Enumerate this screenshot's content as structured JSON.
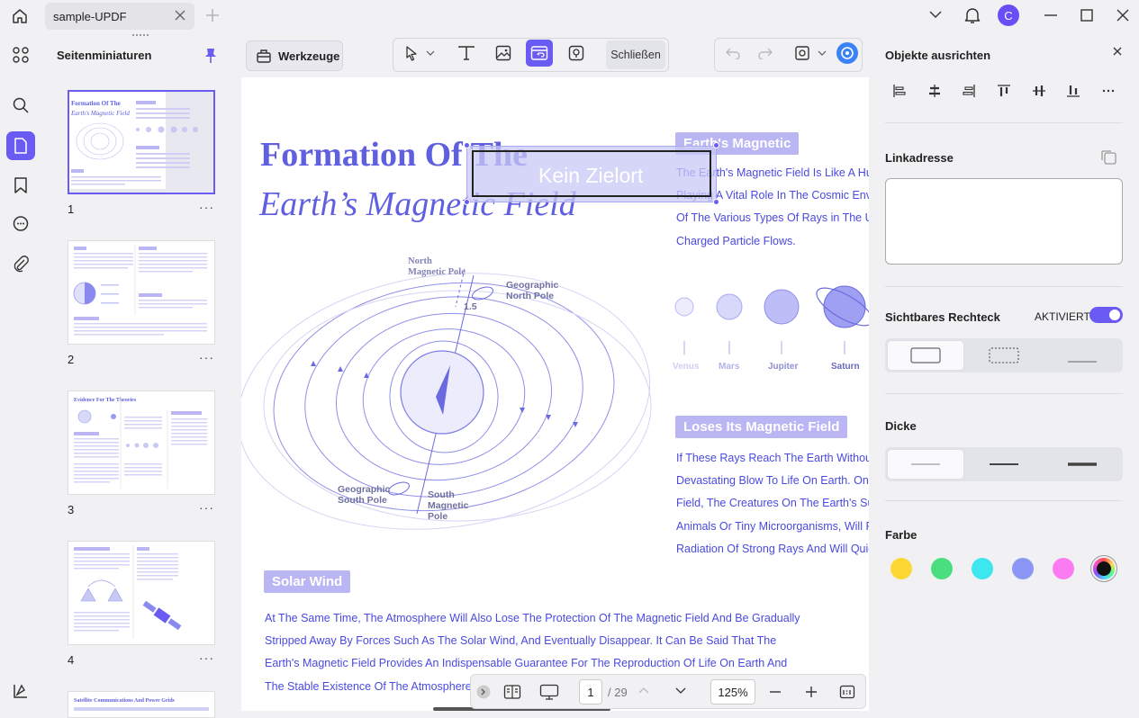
{
  "titlebar": {
    "tab_title": "sample-UPDF",
    "avatar_letter": "C"
  },
  "thumbnails": {
    "title": "Seitenminiaturen",
    "pages": [
      {
        "number": "1",
        "more": "···"
      },
      {
        "number": "2",
        "more": "···"
      },
      {
        "number": "3",
        "more": "···"
      },
      {
        "number": "4",
        "more": "···"
      }
    ]
  },
  "toolbar": {
    "tools_label": "Werkzeuge",
    "close_label": "Schließen"
  },
  "document": {
    "title_line1": "Formation Of The",
    "title_line2": "Earth’s Magnetic Field",
    "section1_title": "Earth's Magnetic",
    "section1_lines": [
      "The Earth's Magnetic Field Is Like A Huge",
      "Playing A Vital Role In The Cosmic Enviro",
      "Of The Various Types Of Rays in The Uni",
      "Charged Particle Flows."
    ],
    "planets": [
      "Venus",
      "Mars",
      "Jupiter",
      "Saturn"
    ],
    "diagram": {
      "north_magnetic_pole": [
        "North",
        "Magnetic Pole"
      ],
      "geographic_north_pole": [
        "Geographic",
        "North Pole"
      ],
      "geographic_south_pole": [
        "Geographic",
        "South Pole"
      ],
      "south_magnetic_pole": [
        "South",
        "Magnetic",
        "Pole"
      ],
      "angle": "1.5"
    },
    "section2_title": "Loses Its Magnetic Field",
    "section2_lines": [
      "If These Rays Reach The Earth Without C",
      "Devastating Blow To Life On Earth. Once",
      "Field, The Creatures On The Earth's Surfa",
      "Animals Or Tiny Microorganisms, Will Fin",
      "Radiation Of Strong Rays And Will Quickl"
    ],
    "section3_title": "Solar Wind",
    "section3_lines": [
      "At The Same Time, The Atmosphere Will Also Lose The Protection Of The Magnetic Field And Be Gradually",
      "Stripped Away By Forces Such As The Solar Wind, And Eventually Disappear. It Can Be Said That The",
      "Earth's Magnetic Field Provides An Indispensable Guarantee For The Reproduction Of Life On Earth And",
      "The Stable Existence Of The Atmosphere B"
    ],
    "link_placeholder": "Kein Zielort"
  },
  "bottombar": {
    "current_page": "1",
    "total_pages": "/ 29",
    "zoom": "125%"
  },
  "properties": {
    "title": "Objekte ausrichten",
    "link_label": "Linkadresse",
    "link_value": "",
    "visible_rect_label": "Sichtbares Rechteck",
    "visible_rect_state": "AKTIVIERT",
    "thickness_label": "Dicke",
    "color_label": "Farbe",
    "colors": [
      "#fdd835",
      "#4ade80",
      "#3ee6f0",
      "#8b97f5",
      "#fb7cf0",
      "#111111"
    ],
    "selected_color": "#111111"
  }
}
